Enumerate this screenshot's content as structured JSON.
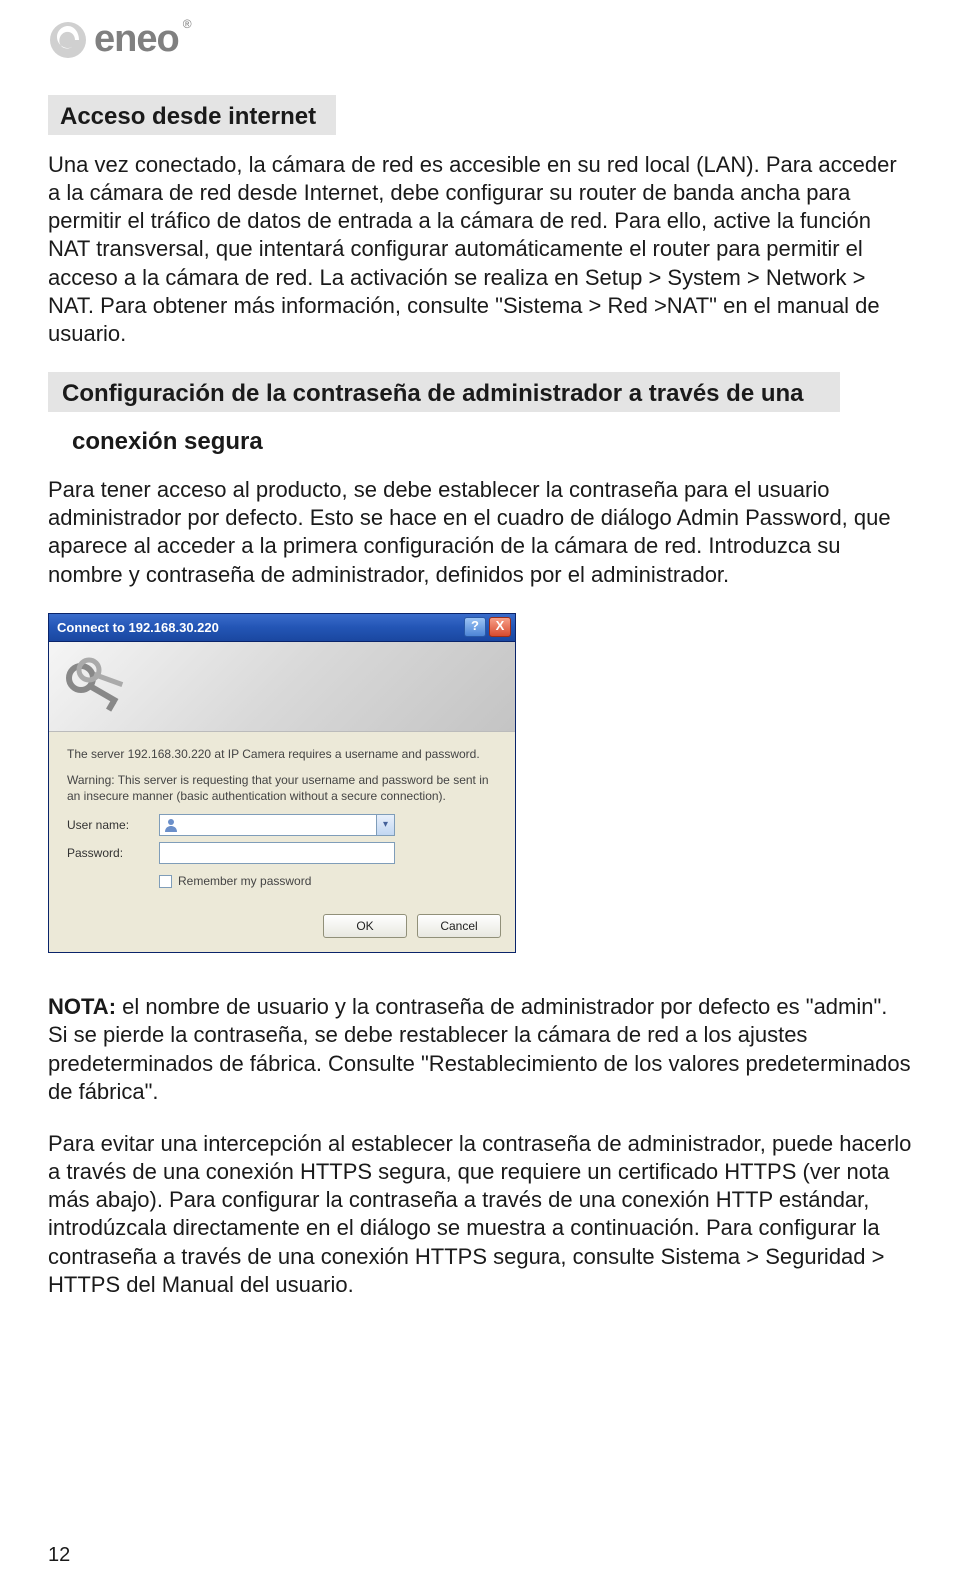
{
  "brand": {
    "name": "eneo"
  },
  "section1": {
    "heading": "Acceso desde internet",
    "body": "Una vez conectado, la cámara de red es accesible en su red local (LAN). Para acceder a la cámara de red desde Internet, debe configurar su router de banda ancha para permitir el tráfico de datos de entrada a la cámara de red. Para ello, active la función NAT transversal, que intentará configurar automáticamente el router para permitir el acceso a la cámara de red. La activación se realiza en Setup > System > Network > NAT. Para obtener más información, consulte \"Sistema > Red >NAT\" en el manual de usuario."
  },
  "section2": {
    "heading_line1": "Configuración de la contraseña de administrador a través de una",
    "heading_line2": "conexión segura",
    "body": "Para tener acceso al producto, se debe establecer la contraseña para el usuario administrador por defecto. Esto se hace en el cuadro de diálogo Admin Password, que aparece al acceder a la primera configuración de la cámara de red. Introduzca su nombre y contraseña de administrador, definidos por el administrador."
  },
  "dialog": {
    "title": "Connect to 192.168.30.220",
    "help": "?",
    "close": "X",
    "msg1": "The server 192.168.30.220 at  IP Camera requires a username and password.",
    "msg2": "Warning: This server is requesting that your username and password be sent in an insecure manner (basic authentication without a secure connection).",
    "user_label": "User name:",
    "pass_label": "Password:",
    "user_value": "",
    "remember": "Remember my password",
    "ok": "OK",
    "cancel": "Cancel"
  },
  "note": {
    "label": "NOTA:",
    "body": " el nombre de usuario y la contraseña de administrador por defecto es \"admin\". Si se pierde la contraseña, se debe restablecer la cámara de red a los ajustes predeterminados de fábrica. Consulte \"Restablecimiento de los valores predeterminados de fábrica\"."
  },
  "para_last": "Para evitar una intercepción al establecer la contraseña de administrador, puede hacerlo a través de una conexión HTTPS segura, que requiere un certificado HTTPS (ver nota más abajo). Para configurar la contraseña a través de una conexión HTTP estándar, introdúzcala directamente en el diálogo se muestra a continuación. Para configurar la contraseña a través de una conexión HTTPS segura, consulte Sistema > Seguridad > HTTPS del Manual del usuario.",
  "page_number": "12"
}
